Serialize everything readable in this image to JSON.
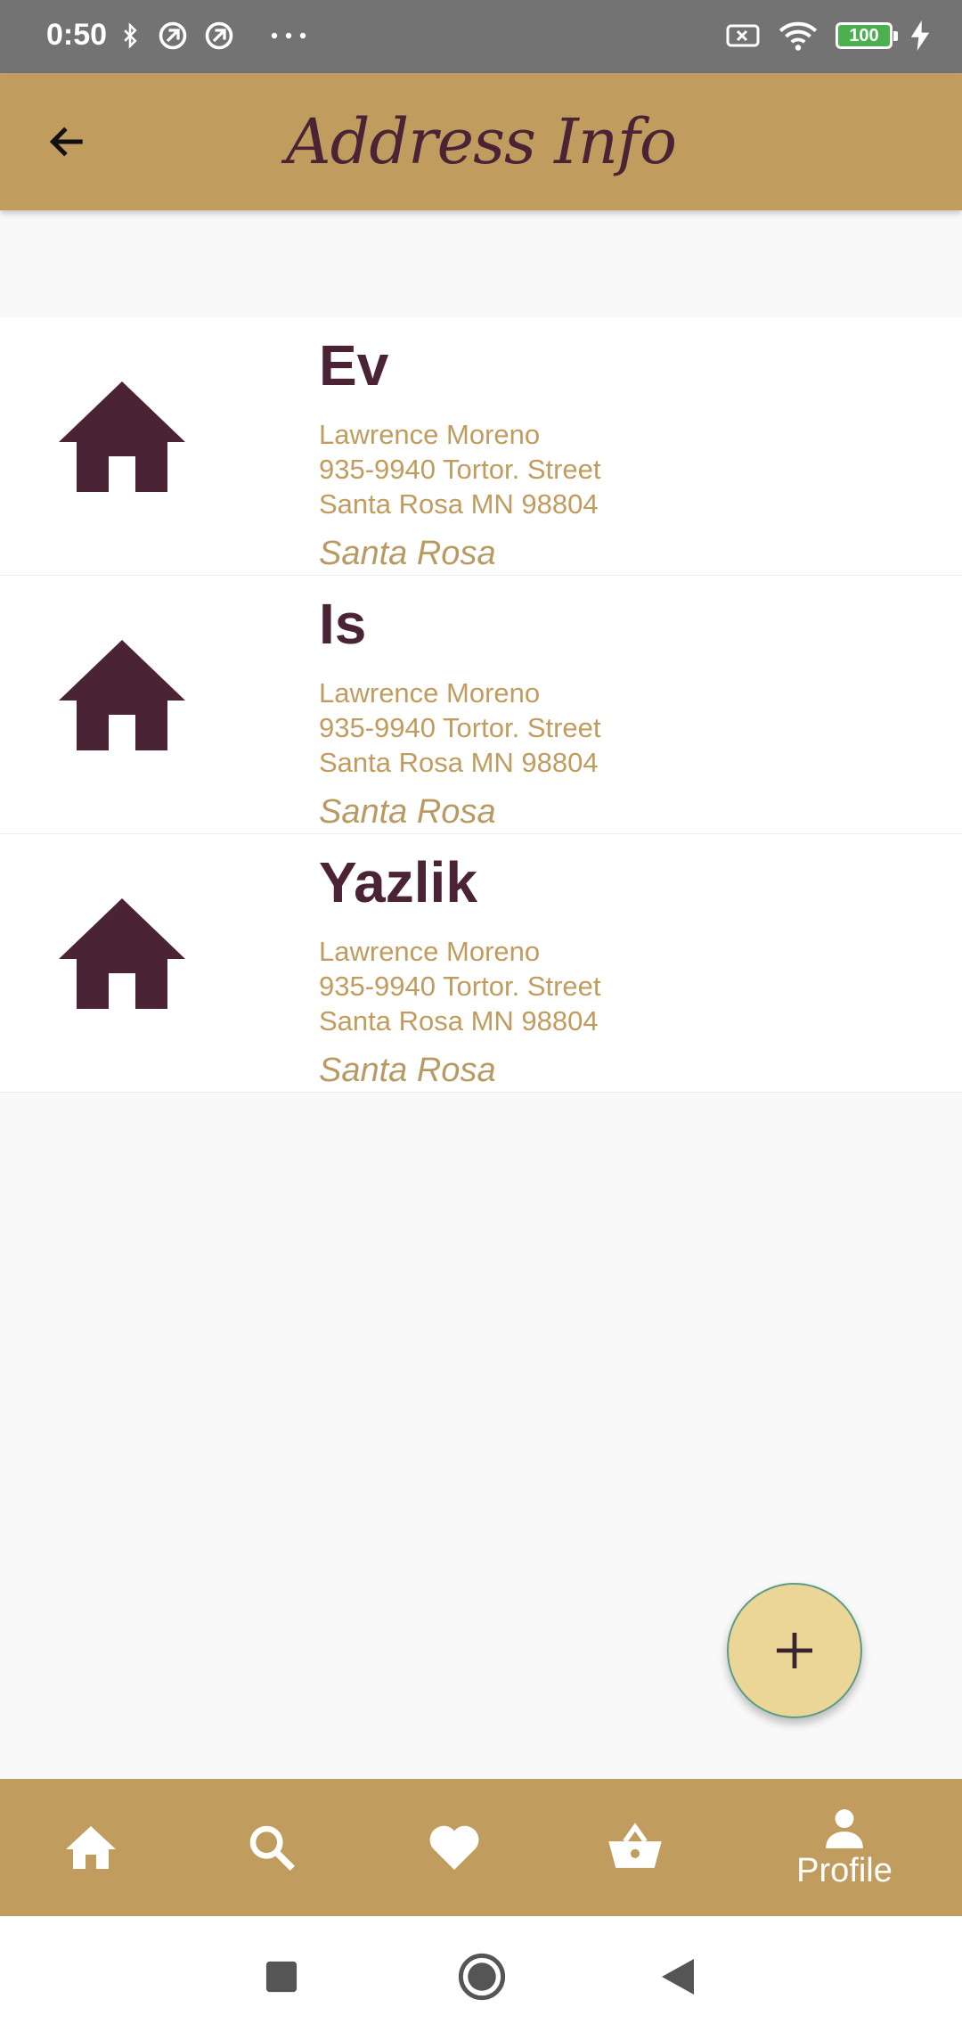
{
  "status_bar": {
    "time": "0:50",
    "battery": "100",
    "icons": [
      "bluetooth-icon",
      "sync-icon",
      "sync-icon",
      "more-icon",
      "no-sim-icon",
      "wifi-icon",
      "battery-icon",
      "charging-icon"
    ]
  },
  "app_bar": {
    "title": "Address Info",
    "back_icon": "arrow-left-icon"
  },
  "addresses": [
    {
      "name": "Ev",
      "lines": [
        "Lawrence Moreno",
        "935-9940 Tortor. Street",
        "Santa Rosa MN 98804"
      ],
      "city": "Santa Rosa",
      "icon": "home-icon"
    },
    {
      "name": "Is",
      "lines": [
        "Lawrence Moreno",
        "935-9940 Tortor. Street",
        "Santa Rosa MN 98804"
      ],
      "city": "Santa Rosa",
      "icon": "home-icon"
    },
    {
      "name": "Yazlik",
      "lines": [
        "Lawrence Moreno",
        "935-9940 Tortor. Street",
        "Santa Rosa MN 98804"
      ],
      "city": "Santa Rosa",
      "icon": "home-icon"
    }
  ],
  "fab": {
    "icon": "plus-icon"
  },
  "bottom_nav": {
    "items": [
      {
        "icon": "home-icon",
        "label": ""
      },
      {
        "icon": "search-icon",
        "label": ""
      },
      {
        "icon": "heart-icon",
        "label": ""
      },
      {
        "icon": "basket-icon",
        "label": ""
      },
      {
        "icon": "person-icon",
        "label": "Profile",
        "selected": true
      }
    ]
  },
  "colors": {
    "accent": "#c19c5f",
    "primary_text": "#4a2435",
    "fab": "#ebd597"
  }
}
